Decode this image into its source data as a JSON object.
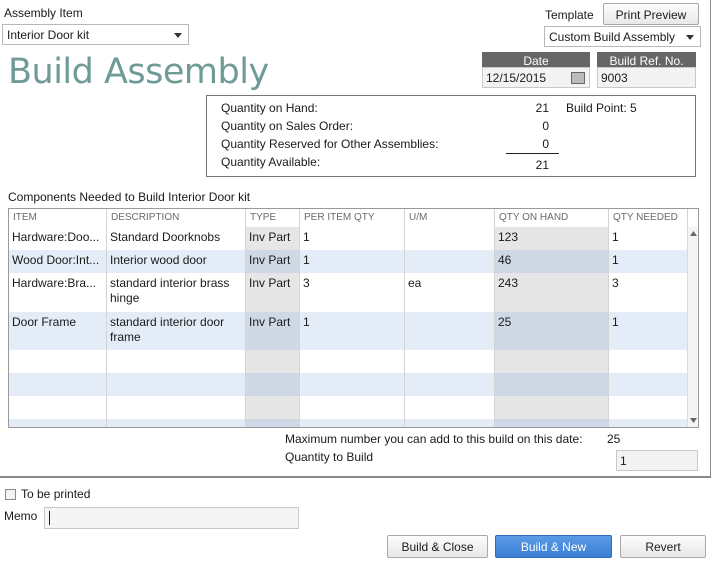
{
  "header": {
    "assembly_item_label": "Assembly Item",
    "assembly_item_value": "Interior Door kit",
    "template_label": "Template",
    "print_preview_label": "Print Preview",
    "template_value": "Custom Build Assembly",
    "form_title": "Build Assembly",
    "date_label": "Date",
    "date_value": "12/15/2015",
    "ref_label": "Build Ref. No.",
    "ref_value": "9003"
  },
  "quantities": {
    "on_hand_label": "Quantity on Hand:",
    "on_hand_value": "21",
    "build_point_label": "Build Point: 5",
    "on_sales_order_label": "Quantity on Sales Order:",
    "on_sales_order_value": "0",
    "reserved_label": "Quantity Reserved for Other Assemblies:",
    "reserved_value": "0",
    "available_label": "Quantity Available:",
    "available_value": "21"
  },
  "components": {
    "heading": "Components Needed to Build  Interior Door kit",
    "columns": [
      "ITEM",
      "DESCRIPTION",
      "TYPE",
      "PER ITEM QTY",
      "U/M",
      "QTY ON HAND",
      "QTY NEEDED"
    ],
    "rows": [
      {
        "item": "Hardware:Doo...",
        "description": "Standard Doorknobs",
        "type": "Inv Part",
        "per_item_qty": "1",
        "um": "",
        "qty_on_hand": "123",
        "qty_needed": "1"
      },
      {
        "item": "Wood Door:Int...",
        "description": "Interior wood door",
        "type": "Inv Part",
        "per_item_qty": "1",
        "um": "",
        "qty_on_hand": "46",
        "qty_needed": "1"
      },
      {
        "item": "Hardware:Bra...",
        "description": "standard interior brass hinge",
        "type": "Inv Part",
        "per_item_qty": "3",
        "um": "ea",
        "qty_on_hand": "243",
        "qty_needed": "3"
      },
      {
        "item": "Door Frame",
        "description": "standard interior door frame",
        "type": "Inv Part",
        "per_item_qty": "1",
        "um": "",
        "qty_on_hand": "25",
        "qty_needed": "1"
      }
    ]
  },
  "build": {
    "max_label": "Maximum number you can add to this build on this date:",
    "max_value": "25",
    "qty_to_build_label": "Quantity to Build",
    "qty_to_build_value": "1"
  },
  "footer": {
    "to_be_printed_label": "To be printed",
    "memo_label": "Memo",
    "memo_value": "",
    "build_close_label": "Build & Close",
    "build_new_label": "Build & New",
    "revert_label": "Revert"
  },
  "colors": {
    "title": "#6f9a96",
    "primary_button": "#3a7fd4",
    "header_cell": "#666666"
  }
}
